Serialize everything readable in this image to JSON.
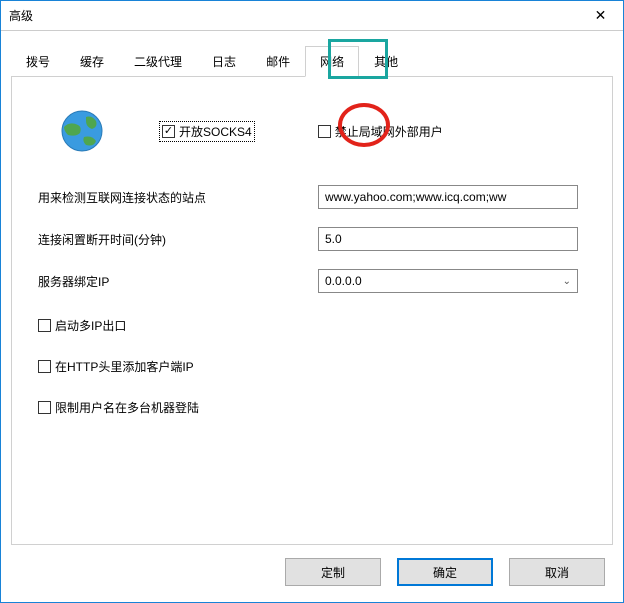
{
  "window": {
    "title": "高级"
  },
  "tabs": {
    "items": [
      {
        "label": "拨号"
      },
      {
        "label": "缓存"
      },
      {
        "label": "二级代理"
      },
      {
        "label": "日志"
      },
      {
        "label": "邮件"
      },
      {
        "label": "网络"
      },
      {
        "label": "其他"
      }
    ],
    "activeIndex": 5
  },
  "network": {
    "openSocks4": {
      "label": "开放SOCKS4",
      "checked": true
    },
    "forbidExternal": {
      "label": "禁止局域网外部用户",
      "checked": false
    },
    "detectLabel": "用来检测互联网连接状态的站点",
    "detectValue": "www.yahoo.com;www.icq.com;ww",
    "idleLabel": "连接闲置断开时间(分钟)",
    "idleValue": "5.0",
    "bindLabel": "服务器绑定IP",
    "bindValue": "0.0.0.0",
    "multiIpExit": {
      "label": "启动多IP出口",
      "checked": false
    },
    "addClientIp": {
      "label": "在HTTP头里添加客户端IP",
      "checked": false
    },
    "limitMultiLogin": {
      "label": "限制用户名在多台机器登陆",
      "checked": false
    }
  },
  "buttons": {
    "custom": "定制",
    "ok": "确定",
    "cancel": "取消"
  }
}
